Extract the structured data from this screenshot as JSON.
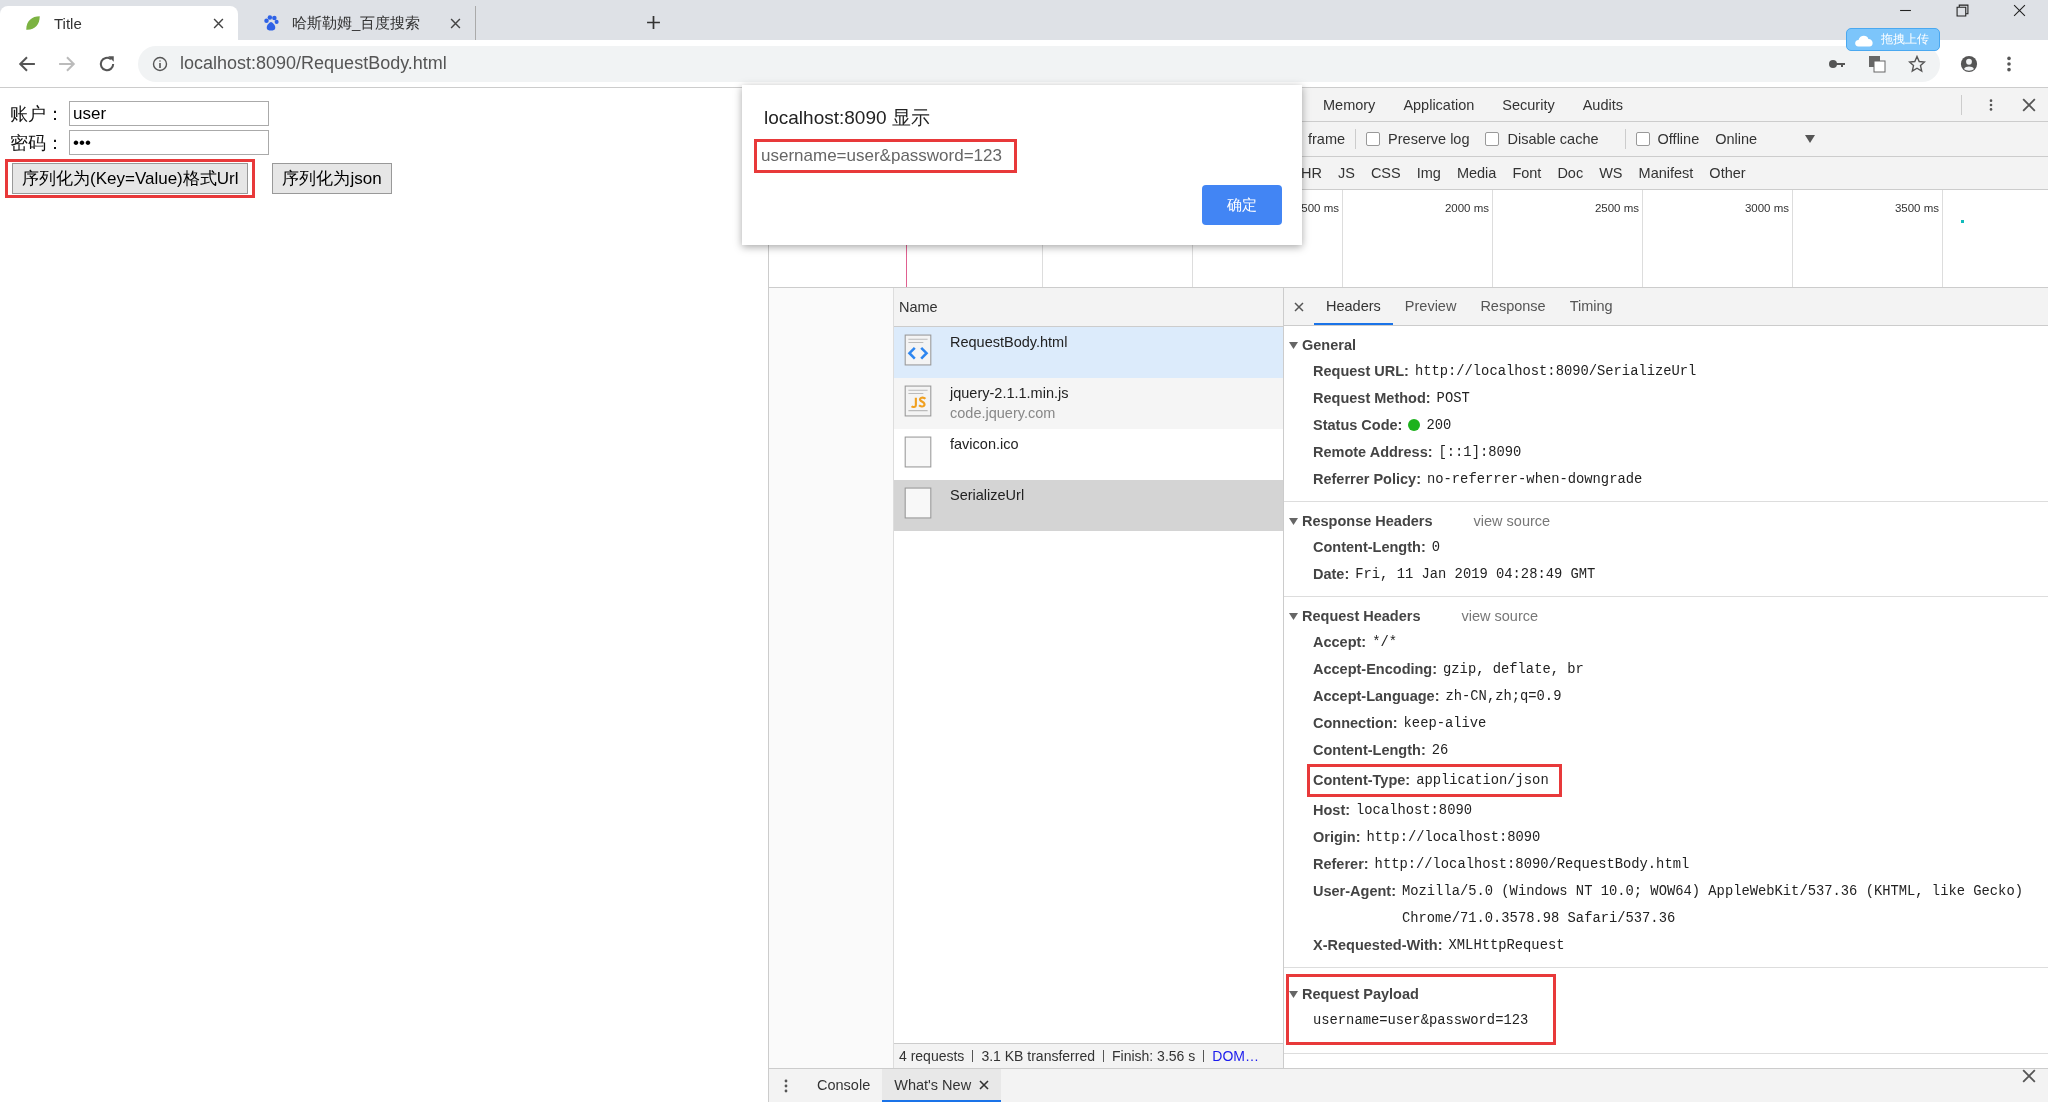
{
  "browser": {
    "tabs": [
      {
        "title": "Title",
        "selected": true
      },
      {
        "title": "哈斯勒姆_百度搜索",
        "selected": false
      }
    ],
    "extension_badge": "拖拽上传",
    "address": "localhost:8090/RequestBody.html"
  },
  "page": {
    "fields": [
      {
        "label": "账户：",
        "value": "user"
      },
      {
        "label": "密码：",
        "value": "•••"
      }
    ],
    "buttons": [
      {
        "label": "序列化为(Key=Value)格式Url",
        "highlighted": true
      },
      {
        "label": "序列化为json"
      }
    ]
  },
  "dialog": {
    "title": "localhost:8090 显示",
    "message": "username=user&password=123",
    "message_highlighted": true,
    "button": "确定"
  },
  "devtools": {
    "panel_tabs": [
      {
        "label": "Memory",
        "selected": false
      },
      {
        "label": "Application",
        "selected": false
      },
      {
        "label": "Security",
        "selected": false
      },
      {
        "label": "Audits",
        "selected": false
      }
    ],
    "toolbar": {
      "partial_label": "frame",
      "checkboxes": [
        {
          "label": "Preserve log",
          "checked": false
        },
        {
          "label": "Disable cache",
          "checked": false
        }
      ],
      "offline": {
        "label": "Offline",
        "checked": false
      },
      "throttling": "Online"
    },
    "filters": [
      {
        "label": "HR",
        "selected": false
      },
      {
        "label": "JS",
        "selected": false
      },
      {
        "label": "CSS",
        "selected": false
      },
      {
        "label": "Img",
        "selected": false
      },
      {
        "label": "Media",
        "selected": false
      },
      {
        "label": "Font",
        "selected": false
      },
      {
        "label": "Doc",
        "selected": false
      },
      {
        "label": "WS",
        "selected": false
      },
      {
        "label": "Manifest",
        "selected": false
      },
      {
        "label": "Other",
        "selected": false
      }
    ],
    "timeline_ticks": [
      "500 ms",
      "2000 ms",
      "2500 ms",
      "3000 ms",
      "3500 ms"
    ],
    "name_column": "Name",
    "requests": [
      {
        "name": "RequestBody.html",
        "kind": "html",
        "selected": false,
        "hovered": true
      },
      {
        "name": "jquery-2.1.1.min.js",
        "domain": "code.jquery.com",
        "kind": "js",
        "selected": false
      },
      {
        "name": "favicon.ico",
        "kind": "blank",
        "selected": false
      },
      {
        "name": "SerializeUrl",
        "kind": "blank",
        "selected": true
      }
    ],
    "summary": [
      "4 requests",
      "3.1 KB transferred",
      "Finish: 3.56 s",
      "DOM…"
    ],
    "detail_tabs": [
      {
        "label": "Headers",
        "selected": true
      },
      {
        "label": "Preview",
        "selected": false
      },
      {
        "label": "Response",
        "selected": false
      },
      {
        "label": "Timing",
        "selected": false
      }
    ],
    "sections": [
      {
        "title": "General",
        "expanded": true,
        "rows": [
          {
            "name": "Request URL:",
            "value": "http://localhost:8090/SerializeUrl"
          },
          {
            "name": "Request Method:",
            "value": "POST"
          },
          {
            "name": "Status Code:",
            "value": "200",
            "color": "#1db21d"
          },
          {
            "name": "Remote Address:",
            "value": "[::1]:8090"
          },
          {
            "name": "Referrer Policy:",
            "value": "no-referrer-when-downgrade"
          }
        ]
      },
      {
        "title": "Response Headers",
        "view_source": "view source",
        "expanded": true,
        "rows": [
          {
            "name": "Content-Length:",
            "value": "0"
          },
          {
            "name": "Date:",
            "value": "Fri, 11 Jan 2019 04:28:49 GMT"
          }
        ]
      },
      {
        "title": "Request Headers",
        "view_source": "view source",
        "expanded": true,
        "rows": [
          {
            "name": "Accept:",
            "value": "*/*"
          },
          {
            "name": "Accept-Encoding:",
            "value": "gzip, deflate, br"
          },
          {
            "name": "Accept-Language:",
            "value": "zh-CN,zh;q=0.9"
          },
          {
            "name": "Connection:",
            "value": "keep-alive"
          },
          {
            "name": "Content-Length:",
            "value": "26"
          },
          {
            "name": "Content-Type:",
            "value": "application/json",
            "highlighted": true
          },
          {
            "name": "Host:",
            "value": "localhost:8090"
          },
          {
            "name": "Origin:",
            "value": "http://localhost:8090"
          },
          {
            "name": "Referer:",
            "value": "http://localhost:8090/RequestBody.html"
          },
          {
            "name": "User-Agent:",
            "value": "Mozilla/5.0 (Windows NT 10.0; WOW64) AppleWebKit/537.36 (KHTML, like Gecko) Chrome/71.0.3578.98 Safari/537.36"
          },
          {
            "name": "X-Requested-With:",
            "value": "XMLHttpRequest"
          }
        ]
      },
      {
        "title": "Request Payload",
        "expanded": true,
        "highlighted": true,
        "rows": [
          {
            "value": "username=user&password=123"
          }
        ]
      }
    ],
    "drawer_tabs": [
      {
        "label": "Console",
        "selected": false
      },
      {
        "label": "What's New",
        "selected": true,
        "closable": true
      }
    ]
  }
}
